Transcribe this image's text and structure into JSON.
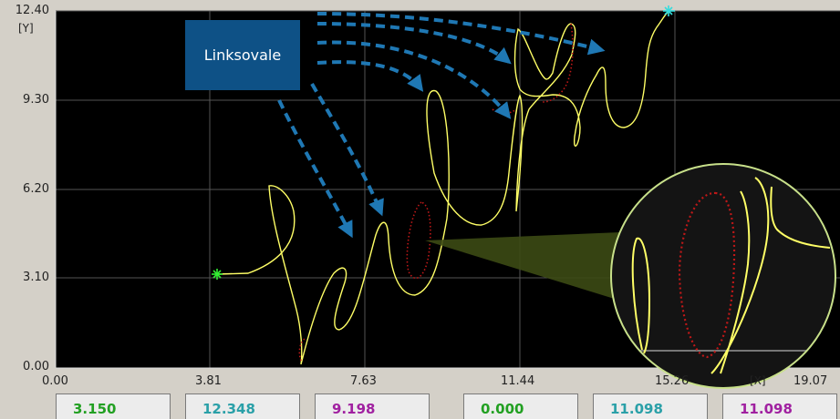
{
  "axes": {
    "y_unit": "[Y]",
    "x_unit": "[X]",
    "y_ticks": [
      "12.40",
      "9.30",
      "6.20",
      "3.10",
      "0.00"
    ],
    "x_ticks": [
      "0.00",
      "3.81",
      "7.63",
      "11.44",
      "15.26",
      "19.07"
    ]
  },
  "callout": {
    "label": "Linksovale"
  },
  "readouts": [
    {
      "value": "3.150",
      "color": "#22a022"
    },
    {
      "value": "12.348",
      "color": "#2aa0a8"
    },
    {
      "value": "9.198",
      "color": "#a020a0"
    },
    {
      "value": "0.000",
      "color": "#22a022"
    },
    {
      "value": "11.098",
      "color": "#2aa0a8"
    },
    {
      "value": "11.098",
      "color": "#a020a0"
    }
  ],
  "colors": {
    "plot_bg": "#000000",
    "trace": "#ffff66",
    "dotted_trace": "#c01818",
    "arrow": "#1f78b4",
    "start_marker": "#33ee33",
    "end_marker": "#33dddd",
    "magnifier_border": "#c8e08a"
  }
}
